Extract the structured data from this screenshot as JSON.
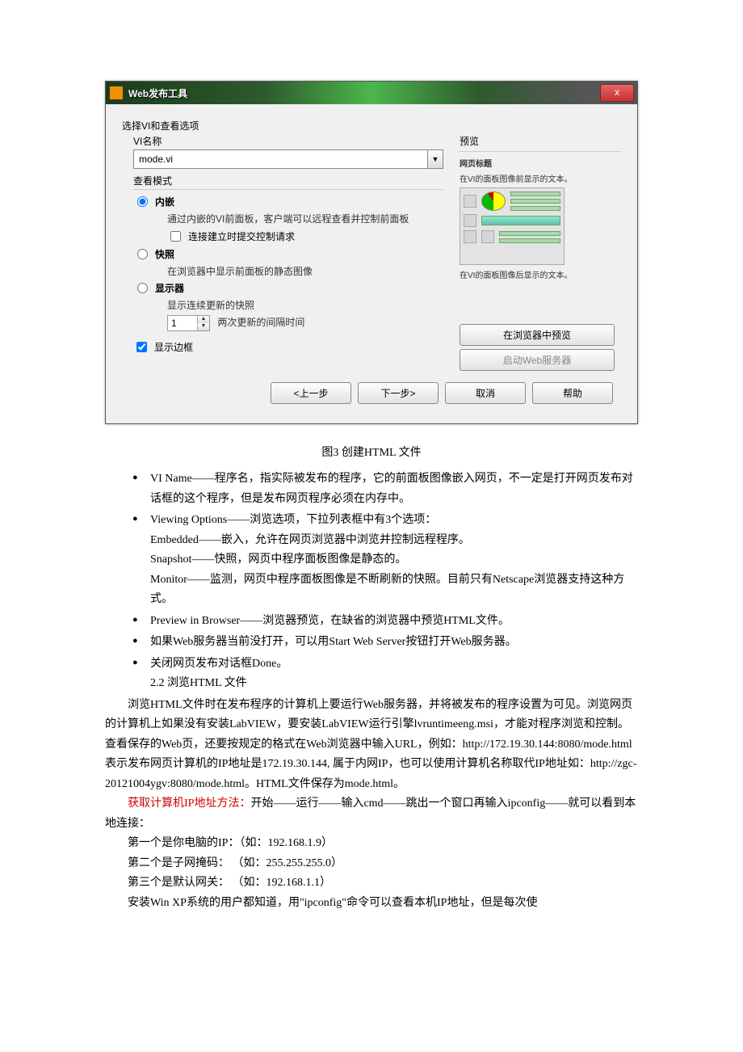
{
  "dialog": {
    "title": "Web发布工具",
    "close": "x",
    "section_label": "选择VI和查看选项",
    "vi_name_label": "VI名称",
    "vi_name_value": "mode.vi",
    "view_mode_label": "查看模式",
    "opt_embedded": "内嵌",
    "opt_embedded_desc": "通过内嵌的VI前面板，客户端可以远程查看并控制前面板",
    "opt_embedded_chk": "连接建立时提交控制请求",
    "opt_snapshot": "快照",
    "opt_snapshot_desc": "在浏览器中显示前面板的静态图像",
    "opt_monitor": "显示器",
    "opt_monitor_desc": "显示连续更新的快照",
    "interval_value": "1",
    "interval_label": "两次更新的间隔时间",
    "preview_label": "预览",
    "preview_title": "网页标题",
    "preview_before": "在VI的面板图像前显示的文本。",
    "preview_after": "在VI的面板图像后显示的文本。",
    "btn_preview": "在浏览器中预览",
    "btn_start_server": "启动Web服务器",
    "show_border": "显示边框",
    "btn_back": "<上一步",
    "btn_next": "下一步>",
    "btn_cancel": "取消",
    "btn_help": "帮助"
  },
  "caption": "图3 创建HTML 文件",
  "bullets": [
    {
      "head": "VI Name——程序名，指实际被发布的程序，它的前面板图像嵌入网页，不一定是打开网页发布对话框的这个程序，但是发布网页程序必须在内存中。"
    },
    {
      "head": "Viewing Options——浏览选项，下拉列表框中有3个选项：",
      "lines": [
        "Embedded——嵌入，允许在网页浏览器中浏览并控制远程程序。",
        "Snapshot——快照，网页中程序面板图像是静态的。",
        "Monitor——监测，网页中程序面板图像是不断刷新的快照。目前只有Netscape浏览器支持这种方式。"
      ]
    },
    {
      "head": "Preview in Browser——浏览器预览，在缺省的浏览器中预览HTML文件。"
    },
    {
      "head": "如果Web服务器当前没打开，可以用Start Web Server按钮打开Web服务器。"
    },
    {
      "head": "关闭网页发布对话框Done。",
      "lines": [
        "2.2 浏览HTML 文件"
      ]
    }
  ],
  "paragraphs": {
    "p1": "浏览HTML文件时在发布程序的计算机上要运行Web服务器，并将被发布的程序设置为可见。浏览网页的计算机上如果没有安装LabVIEW，要安装LabVIEW运行引擎lvruntimeeng.msi，才能对程序浏览和控制。查看保存的Web页，还要按规定的格式在Web浏览器中输入URL，例如：http://172.19.30.144:8080/mode.html表示发布网页计算机的IP地址是172.19.30.144, 属于内网IP，也可以使用计算机名称取代IP地址如：http://zgc-20121004ygv:8080/mode.html。HTML文件保存为mode.html。",
    "p2_red": "获取计算机IP地址方法：",
    "p2_rest": "开始——运行——输入cmd——跳出一个窗口再输入ipconfig——就可以看到本地连接：",
    "p3": "第一个是你电脑的IP：（如：192.168.1.9）",
    "p4": "第二个是子网掩码： （如：255.255.255.0）",
    "p5": "第三个是默认网关： （如：192.168.1.1）",
    "p6": "安装Win XP系统的用户都知道，用\"ipconfig\"命令可以查看本机IP地址，但是每次使"
  }
}
